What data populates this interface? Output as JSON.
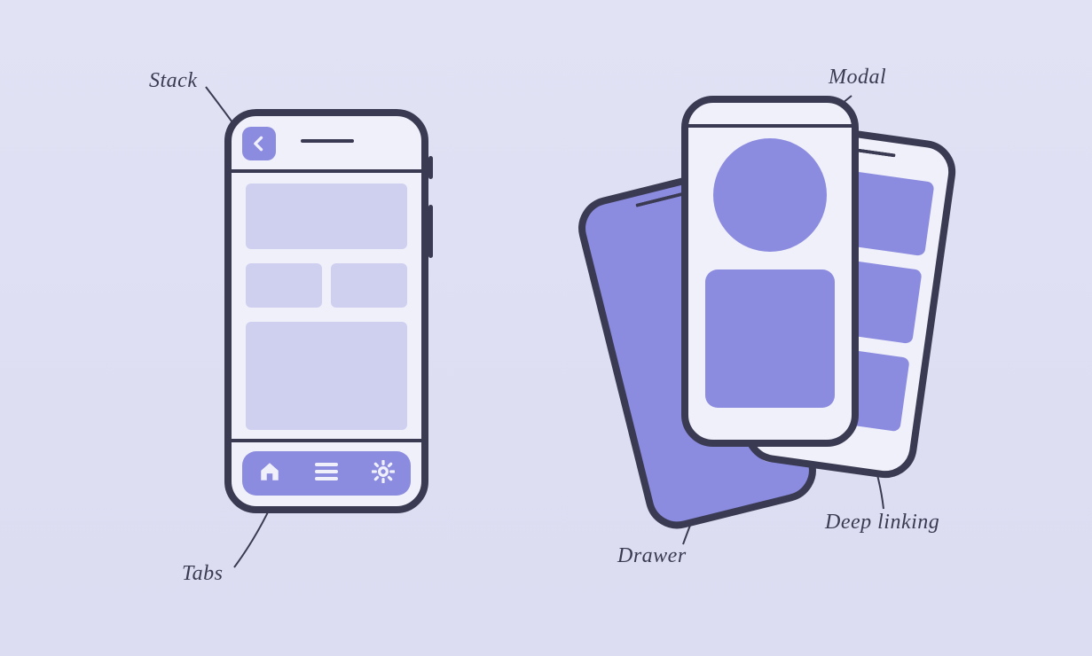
{
  "labels": {
    "stack": "Stack",
    "tabs": "Tabs",
    "modal": "Modal",
    "drawer": "Drawer",
    "deep_linking": "Deep linking"
  },
  "devices": {
    "left": {
      "header": {
        "back_icon": "chevron-left",
        "speaker": true
      },
      "content_blocks": [
        {
          "kind": "wide"
        },
        {
          "kind": "half"
        },
        {
          "kind": "half"
        },
        {
          "kind": "tall"
        }
      ],
      "tab_bar": {
        "items": [
          {
            "icon": "home"
          },
          {
            "icon": "menu"
          },
          {
            "icon": "gear"
          }
        ]
      }
    },
    "right_stack": {
      "drawer_phone": {
        "fill": "#8b8be0",
        "light_strip": true
      },
      "deep_linking_phone": {
        "rows": [
          {
            "kind": "row"
          },
          {
            "kind": "row"
          },
          {
            "kind": "row"
          }
        ]
      },
      "modal_phone": {
        "status_bar": true,
        "shapes": [
          {
            "kind": "circle"
          },
          {
            "kind": "rounded-square"
          }
        ]
      }
    }
  },
  "colors": {
    "outline": "#3a3a52",
    "accent": "#8b8be0",
    "panel": "#cfcfef",
    "device_bg": "#f0f0fa",
    "page_bg_top": "#e2e2f5",
    "page_bg_bottom": "#dcdcf2"
  }
}
